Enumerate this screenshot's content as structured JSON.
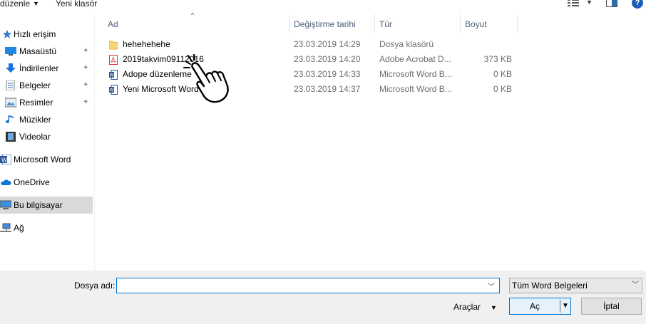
{
  "toolbar": {
    "organize_label": "düzenle",
    "new_folder_label": "Yeni klasör"
  },
  "nav": {
    "items": [
      {
        "label": "Hızlı erişim",
        "icon": "star-icon"
      },
      {
        "label": "Masaüstü",
        "icon": "desktop-icon",
        "pinned": true
      },
      {
        "label": "İndirilenler",
        "icon": "download-icon",
        "pinned": true
      },
      {
        "label": "Belgeler",
        "icon": "documents-icon",
        "pinned": true
      },
      {
        "label": "Resimler",
        "icon": "pictures-icon",
        "pinned": true
      },
      {
        "label": "Müzikler",
        "icon": "music-icon"
      },
      {
        "label": "Videolar",
        "icon": "videos-icon"
      },
      {
        "label": "Microsoft Word",
        "icon": "word-icon"
      },
      {
        "label": "OneDrive",
        "icon": "onedrive-icon"
      },
      {
        "label": "Bu bilgisayar",
        "icon": "computer-icon",
        "selected": true
      },
      {
        "label": "Ağ",
        "icon": "network-icon"
      }
    ]
  },
  "list": {
    "columns": {
      "name": "Ad",
      "date": "Değiştirme tarihi",
      "type": "Tür",
      "size": "Boyut"
    },
    "rows": [
      {
        "name": "hehehehehe",
        "date": "23.03.2019 14:29",
        "type": "Dosya klasörü",
        "size": "",
        "icon": "folder-icon"
      },
      {
        "name": "2019takvim09112016",
        "date": "23.03.2019 14:20",
        "type": "Adobe Acrobat D...",
        "size": "373 KB",
        "icon": "pdf-icon"
      },
      {
        "name": "Adope düzenleme",
        "date": "23.03.2019 14:33",
        "type": "Microsoft Word B...",
        "size": "0 KB",
        "icon": "word-doc-icon"
      },
      {
        "name": "Yeni Microsoft Word Belgesi",
        "date": "23.03.2019 14:37",
        "type": "Microsoft Word B...",
        "size": "0 KB",
        "icon": "word-doc-icon"
      }
    ]
  },
  "bottom": {
    "filename_label": "Dosya adı:",
    "filename_value": "",
    "filter_value": "Tüm Word Belgeleri",
    "tools_label": "Araçlar",
    "open_label": "Aç",
    "cancel_label": "İptal"
  },
  "colors": {
    "accent": "#0078d7",
    "selected_bg": "#d9d9d9",
    "bottom_bg": "#f0f0f0",
    "header_text": "#4c607a"
  }
}
